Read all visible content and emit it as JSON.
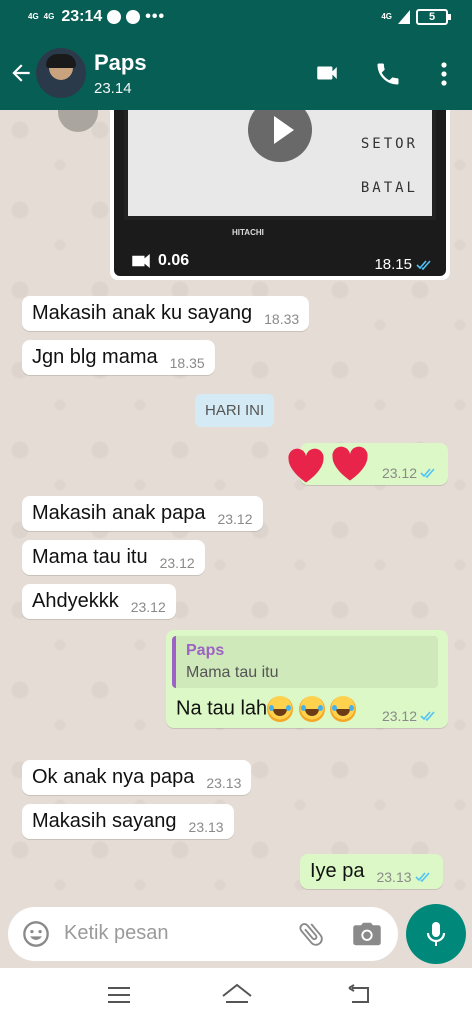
{
  "status_bar": {
    "network1": "4G",
    "network2": "4G",
    "time": "23:14",
    "more": "•••",
    "lte": "4G",
    "battery": "5"
  },
  "header": {
    "contact_name": "Paps",
    "last_seen": "23.14"
  },
  "video_message": {
    "menu_item_1": "SETOR",
    "menu_item_2": "BATAL",
    "brand": "HITACHI",
    "duration": "0.06",
    "time": "18.15"
  },
  "messages": [
    {
      "text": "Makasih anak ku sayang",
      "time": "18.33"
    },
    {
      "text": "Jgn blg mama",
      "time": "18.35"
    },
    {
      "text": "Makasih anak papa",
      "time": "23.12"
    },
    {
      "text": "Mama tau itu",
      "time": "23.12"
    },
    {
      "text": "Ahdyekkk",
      "time": "23.12"
    },
    {
      "text": "Ok anak nya papa",
      "time": "23.13"
    },
    {
      "text": "Makasih sayang",
      "time": "23.13"
    }
  ],
  "day_divider": "HARI INI",
  "sent": {
    "hearts_time": "23.12",
    "reply_quote_name": "Paps",
    "reply_quote_text": "Mama tau itu",
    "reply_text": "Na tau lah",
    "reply_time": "23.12",
    "last_text": "Iye pa",
    "last_time": "23.13"
  },
  "input": {
    "placeholder": "Ketik pesan"
  },
  "colors": {
    "header": "#075e54",
    "outgoing": "#dcf8c6",
    "incoming": "#ffffff",
    "read_ticks": "#4fc3f7",
    "mic": "#00897b"
  }
}
